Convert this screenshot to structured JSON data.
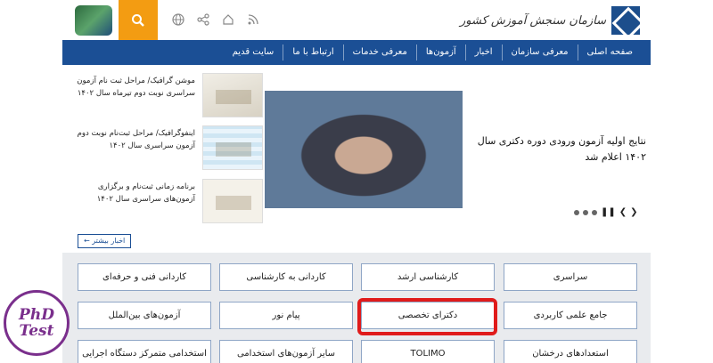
{
  "header": {
    "logo_text": "سازمان سنجش آموزش کشور",
    "icons": [
      "rss-icon",
      "home-icon",
      "share-icon",
      "globe-icon"
    ]
  },
  "nav": {
    "items": [
      "صفحه اصلی",
      "معرفی سازمان",
      "اخبار",
      "آزمون‌ها",
      "معرفی خدمات",
      "ارتباط با ما",
      "سایت قدیم"
    ]
  },
  "news": {
    "main_title": "نتایج اولیه آزمون ورودی دوره دکتری سال ۱۴۰۲ اعلام شد",
    "side": [
      "موشن گرافیک/ مراحل ثبت نام آزمون سراسری نوبت دوم تیرماه سال ۱۴۰۲",
      "اینفوگرافیک/ مراحل ثبت‌نام نوبت دوم آزمون سراسری سال ۱۴۰۲",
      "برنامه زمانی ثبت‌نام و برگزاری آزمون‌های سراسری سال ۱۴۰۲"
    ],
    "more_label": "اخبار بیشتر"
  },
  "exams": {
    "row1": [
      "سراسری",
      "کارشناسی ارشد",
      "کاردانی به کارشناسی",
      "کاردانی فنی و حرفه‌ای"
    ],
    "row2": [
      "جامع علمی کاربردی",
      "دکترای تخصصی",
      "پیام نور",
      "آزمون‌های بین‌الملل"
    ],
    "row3": [
      "استعدادهای درخشان",
      "TOLIMO",
      "سایر آزمون‌های استخدامی",
      "استخدامی متمرکز دستگاه اجرایی"
    ]
  },
  "badge": {
    "line1": "PhD",
    "line2": "Test"
  },
  "colors": {
    "nav_bg": "#1b4f95",
    "search_bg": "#f39c12",
    "highlight": "#e01b1b",
    "badge": "#7a2f8c"
  }
}
